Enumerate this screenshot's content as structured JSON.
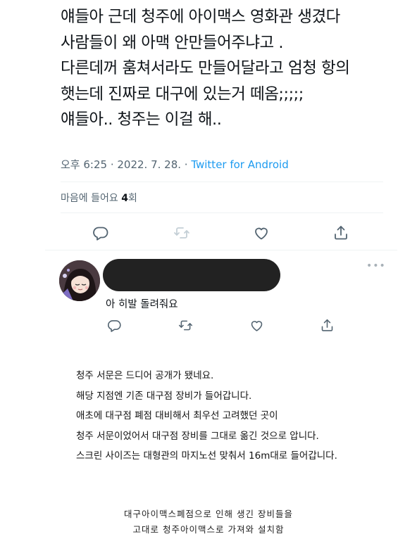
{
  "tweet": {
    "lines": [
      "얘들아 근데 청주에 아이맥스 영화관 생겼다",
      "사람들이 왜 아맥 안만들어주냐고 .",
      "다른데꺼 훔쳐서라도 만들어달라고 엄청 항의",
      "햇는데 진짜로 대구에 있는거 떼옴;;;;;",
      "얘들아.. 청주는 이걸 해.."
    ],
    "time": "오후 6:25 · 2022. 7. 28. · ",
    "source": "Twitter for Android",
    "likes_label": "마음에 들어요 ",
    "likes_count": "4",
    "likes_unit": "회"
  },
  "icons": {
    "reply": "reply-icon",
    "retweet": "retweet-icon",
    "like": "heart-icon",
    "share": "share-icon",
    "more": "more-icon"
  },
  "reply": {
    "more_label": "•••",
    "text": "아 히발 돌려줘요"
  },
  "article": {
    "lines": [
      "청주 서문은 드디어 공개가 됐네요.",
      "해당 지점엔 기존 대구점 장비가 들어갑니다.",
      "애초에 대구점 폐점 대비해서 최우선 고려했던 곳이",
      "청주 서문이었어서 대구점 장비를 그대로 옮긴 것으로 압니다.",
      "스크린 사이즈는 대형관의 마지노선 맞춰서 16m대로 들어갑니다."
    ]
  },
  "caption": {
    "lines": [
      "대구아이맥스폐점으로 인해 생긴 장비들을",
      "고대로 청주아이맥스로 가져와 설치함"
    ]
  },
  "colors": {
    "text": "#0f1419",
    "muted": "#536471",
    "link": "#1d9bf0",
    "icon_main": "#536471",
    "icon_retweet_disabled": "#c4cfd6"
  }
}
